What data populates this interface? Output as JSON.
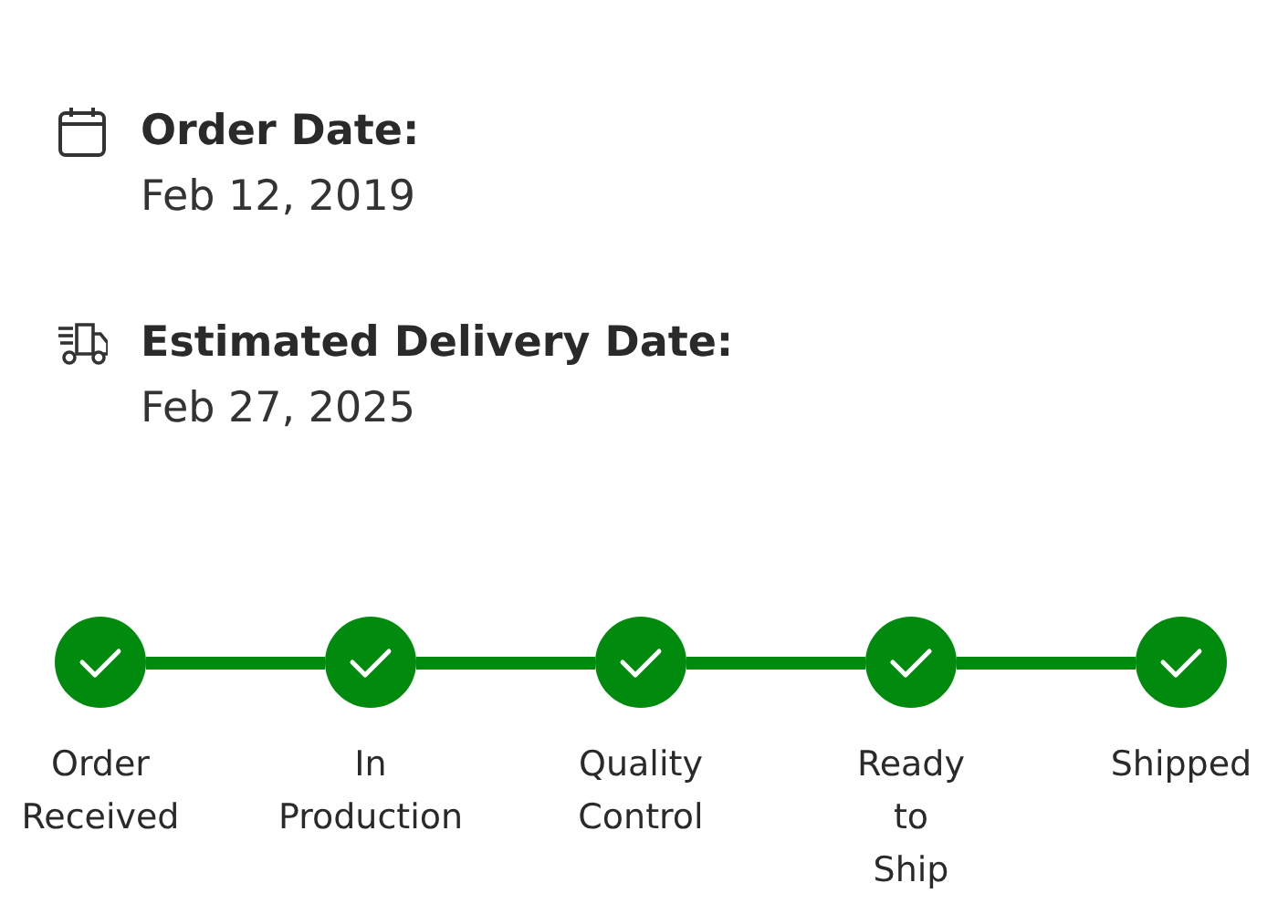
{
  "details": [
    {
      "kind": "calendar",
      "title": "Order Date:",
      "value": "Feb 12, 2019"
    },
    {
      "kind": "truck",
      "title": "Estimated Delivery Date:",
      "value": "Feb 27, 2025"
    }
  ],
  "steps": [
    {
      "label": "Order Received",
      "done": true
    },
    {
      "label": "In Production",
      "done": true
    },
    {
      "label": "Quality Control",
      "done": true
    },
    {
      "label": "Ready to Ship",
      "done": true
    },
    {
      "label": "Shipped",
      "done": true
    }
  ]
}
